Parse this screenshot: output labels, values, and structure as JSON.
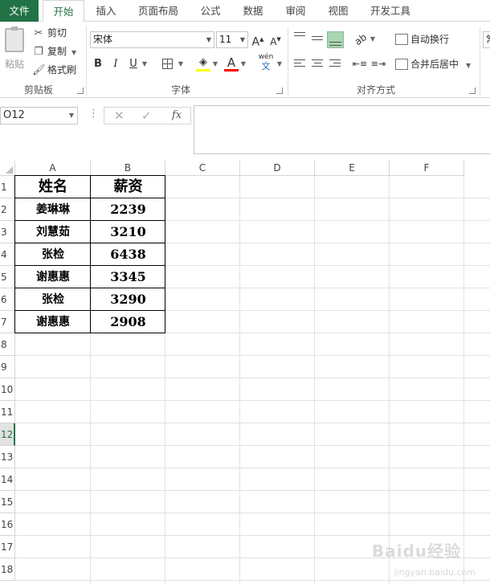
{
  "ribbon_tabs": [
    "文件",
    "开始",
    "插入",
    "页面布局",
    "公式",
    "数据",
    "审阅",
    "视图",
    "开发工具"
  ],
  "clipboard": {
    "paste_label": "粘贴",
    "cut_label": "剪切",
    "copy_label": "复制",
    "format_painter_label": "格式刷",
    "group_label": "剪贴板"
  },
  "font": {
    "font_name": "宋体",
    "font_size": "11",
    "bold": "B",
    "italic": "I",
    "underline": "U",
    "increase_size": "A",
    "decrease_size": "A",
    "font_color_glyph": "A",
    "phonetic_label": "wén",
    "phonetic_char": "文",
    "highlight_color": "#ffff00",
    "font_color": "#ff0000",
    "group_label": "字体"
  },
  "alignment": {
    "wrap_text_label": "自动换行",
    "merge_center_label": "合并后居中",
    "group_label": "对齐方式",
    "selected_color": "#a9d5b0"
  },
  "number_group_partial": "常",
  "formula_bar": {
    "name_box": "O12",
    "cancel_icon": "✕",
    "enter_icon": "✓",
    "fx_label": "fx",
    "formula": ""
  },
  "grid": {
    "columns": [
      "A",
      "B",
      "C",
      "D",
      "E",
      "F"
    ],
    "rows": [
      "1",
      "2",
      "3",
      "4",
      "5",
      "6",
      "7",
      "8",
      "9",
      "10",
      "11",
      "12",
      "13",
      "14",
      "15",
      "16",
      "17",
      "18"
    ],
    "selected_row": "12",
    "table_header": {
      "name": "姓名",
      "salary": "薪资"
    },
    "table_rows": [
      {
        "name": "姜琳琳",
        "salary": "2239"
      },
      {
        "name": "刘慧茹",
        "salary": "3210"
      },
      {
        "name": "张检",
        "salary": "6438"
      },
      {
        "name": "谢惠惠",
        "salary": "3345"
      },
      {
        "name": "张检",
        "salary": "3290"
      },
      {
        "name": "谢惠惠",
        "salary": "2908"
      }
    ]
  },
  "accent_color": "#217346",
  "watermark": {
    "text": "Baidu经验",
    "sub": "jingyan.baidu.com"
  }
}
